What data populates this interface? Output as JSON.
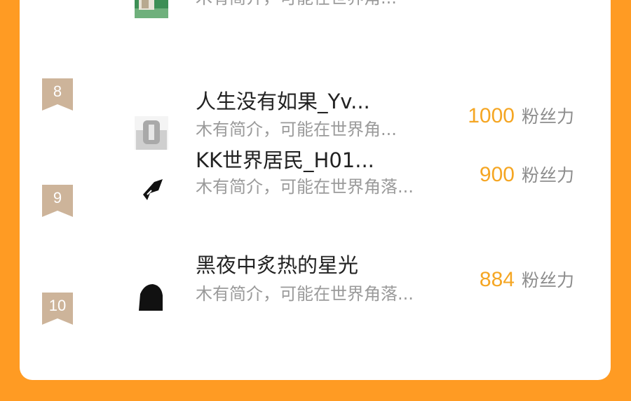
{
  "colors": {
    "page_background": "#FF9B23",
    "card_background": "#FFFFFF",
    "rank_badge": "#CDB49A",
    "score": "#F5A623",
    "username": "#222222",
    "bio": "#9A9A9A"
  },
  "leaderboard": {
    "partial_top_row": {
      "bio": "木有简介，可能在世界角..."
    },
    "rows": [
      {
        "rank": "8",
        "username": "人生没有如果_Yv...",
        "bio": "木有简介，可能在世界角...",
        "score": "1000",
        "score_unit": "粉丝力",
        "avatar_icon": "gray-photo-avatar"
      },
      {
        "rank": "9",
        "username": "KK世界居民_H01...",
        "bio": "木有简介，可能在世界角落...",
        "score": "900",
        "score_unit": "粉丝力",
        "avatar_icon": "black-shape-avatar"
      },
      {
        "rank": "10",
        "username": "黑夜中炙热的星光",
        "bio": "木有简介，可能在世界角落...",
        "score": "884",
        "score_unit": "粉丝力",
        "avatar_icon": "dark-silhouette-avatar"
      }
    ]
  }
}
